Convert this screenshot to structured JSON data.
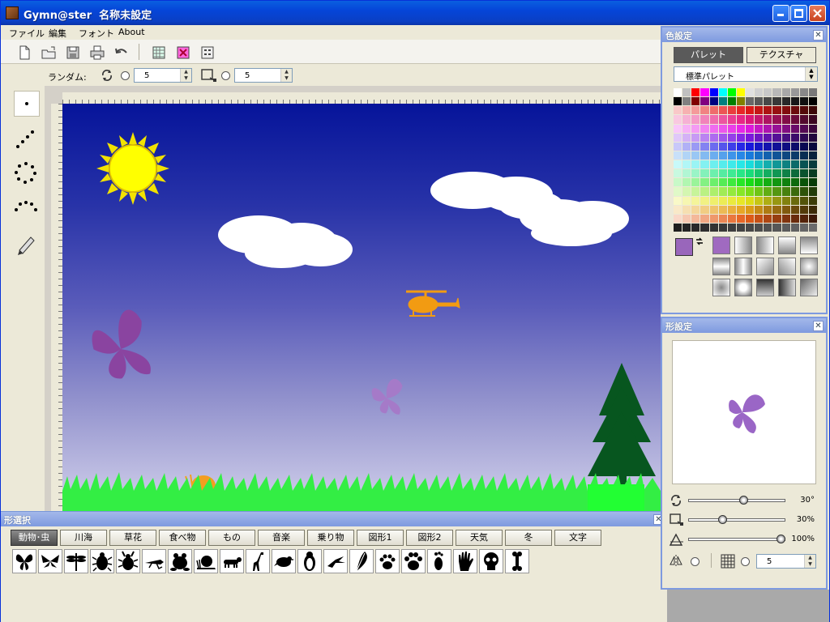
{
  "window": {
    "title": "Gymn@ster  名称未設定"
  },
  "menu": {
    "items": [
      "ファイル",
      "編集",
      "フォント",
      "About"
    ]
  },
  "options": {
    "label": "ランダム:",
    "rotate_value": "5",
    "size_value": "5"
  },
  "color_panel": {
    "title": "色設定",
    "tabs": [
      "パレット",
      "テクスチャ"
    ],
    "palette_select": "標準パレット",
    "current_fill": "#9966bb",
    "current_stroke": "#22ee22"
  },
  "form_panel": {
    "title": "形設定",
    "rotation_value": "30°",
    "size_value": "30%",
    "opacity_value": "100%",
    "grid_value": "5"
  },
  "shape_panel": {
    "title": "形選択",
    "categories": [
      "動物･虫",
      "川海",
      "草花",
      "食べ物",
      "もの",
      "音楽",
      "乗り物",
      "図形1",
      "図形2",
      "天気",
      "冬",
      "文字"
    ],
    "selected_category": "動物･虫",
    "shapes": [
      "butterfly-1",
      "butterfly-2",
      "dragonfly",
      "beetle",
      "stag-beetle",
      "grasshopper",
      "frog",
      "snail",
      "dachshund",
      "giraffe",
      "bird",
      "penguin",
      "crane",
      "feather",
      "paw-1",
      "paw-2",
      "footprint",
      "hand",
      "skull",
      "bone"
    ]
  }
}
